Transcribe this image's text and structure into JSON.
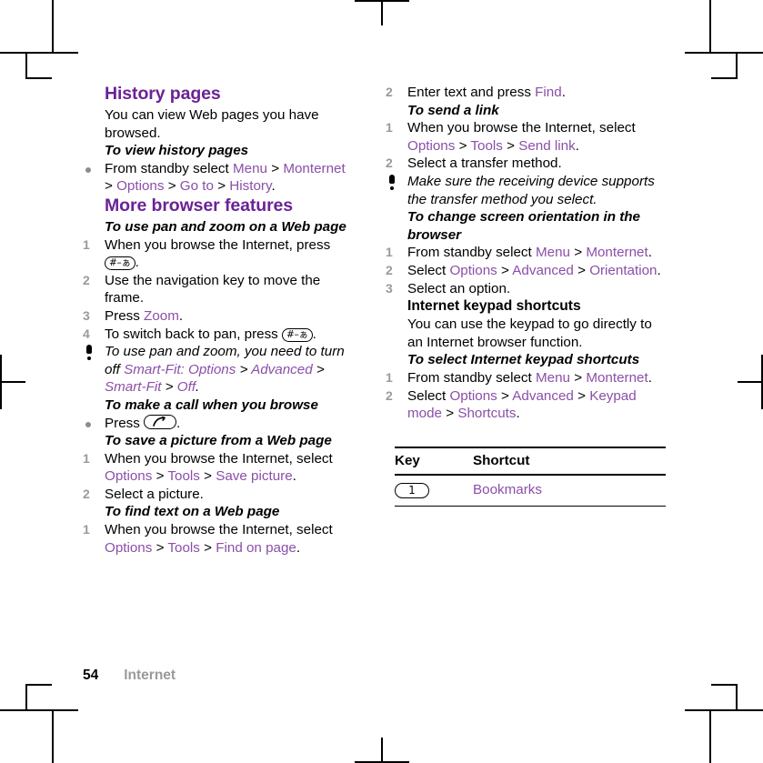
{
  "footer": {
    "page_number": "54",
    "section": "Internet"
  },
  "colors": {
    "heading_purple": "#6B2296",
    "link_purple": "#8B4FA8",
    "step_number_gray": "#9a9a9a",
    "footer_section_gray": "#9a9a9a"
  },
  "left_column": {
    "history": {
      "heading": "History pages",
      "intro": "You can view Web pages you have browsed.",
      "sub1": "To view history pages",
      "b1_pre": "From standby select ",
      "b1_l1": "Menu",
      "b1_l2": "Monternet",
      "b1_l3": "Options",
      "b1_l4": "Go to",
      "b1_l5": "History"
    },
    "more": {
      "heading": "More browser features",
      "panzoom": {
        "sub": "To use pan and zoom on a Web page",
        "s1_pre": "When you browse the Internet, press ",
        "s1_key": "#–ぁ",
        "s2": "Use the navigation key to move the frame.",
        "s3_pre": "Press ",
        "s3_link": "Zoom",
        "s4_pre": "To switch back to pan, press ",
        "s4_key": "#–ぁ",
        "tip_pre": "To use pan and zoom, you need to turn off ",
        "tip_l1": "Smart-Fit",
        "tip_mid": ": ",
        "tip_l2": "Options",
        "tip_l3": "Advanced",
        "tip_l4": "Smart-Fit",
        "tip_l5": "Off"
      },
      "call": {
        "sub": "To make a call when you browse",
        "b1_pre": "Press ",
        "b1_key": "call-key"
      },
      "savepic": {
        "sub": "To save a picture from a Web page",
        "s1_pre": "When you browse the Internet, select ",
        "s1_l1": "Options",
        "s1_l2": "Tools",
        "s1_l3": "Save picture",
        "s2": "Select a picture."
      },
      "findtext": {
        "sub": "To find text on a Web page",
        "s1_pre": "When you browse the Internet, select ",
        "s1_l1": "Options",
        "s1_l2": "Tools",
        "s1_l3": "Find on page"
      }
    }
  },
  "right_column": {
    "findtext_cont": {
      "s2_pre": "Enter text and press ",
      "s2_link": "Find"
    },
    "sendlink": {
      "sub": "To send a link",
      "s1_pre": "When you browse the Internet, select ",
      "s1_l1": "Options",
      "s1_l2": "Tools",
      "s1_l3": "Send link",
      "s2": "Select a transfer method.",
      "tip": "Make sure the receiving device supports the transfer method you select."
    },
    "orientation": {
      "sub": "To change screen orientation in the browser",
      "s1_pre": "From standby select ",
      "s1_l1": "Menu",
      "s1_l2": "Monternet",
      "s2_pre": "Select ",
      "s2_l1": "Options",
      "s2_l2": "Advanced",
      "s2_l3": "Orientation",
      "s3": "Select an option."
    },
    "keypad": {
      "heading": "Internet keypad shortcuts",
      "intro": "You can use the keypad to go directly to an Internet browser function.",
      "sub": "To select Internet keypad shortcuts",
      "s1_pre": "From standby select ",
      "s1_l1": "Menu",
      "s1_l2": "Monternet",
      "s2_pre": "Select ",
      "s2_l1": "Options",
      "s2_l2": "Advanced",
      "s2_l3": "Keypad mode",
      "s2_l4": "Shortcuts"
    },
    "table": {
      "headers": [
        "Key",
        "Shortcut"
      ],
      "rows": [
        {
          "key": "1",
          "shortcut": "Bookmarks"
        }
      ]
    }
  },
  "separators": {
    "gt": ">"
  },
  "step_numbers": {
    "one": "1",
    "two": "2",
    "three": "3",
    "four": "4"
  }
}
